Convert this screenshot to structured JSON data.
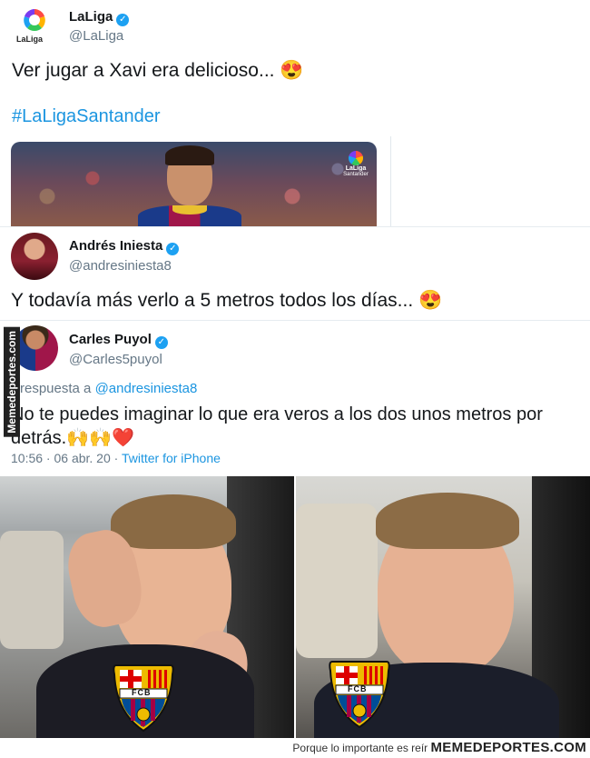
{
  "laliga_tweet": {
    "name": "LaLiga",
    "handle": "@LaLiga",
    "text": "Ver jugar a Xavi era delicioso... 😍",
    "hashtag": "#LaLigaSantander",
    "logo_text": "LaLiga",
    "media_logo_text": "LaLiga",
    "media_logo_sub": "Santander"
  },
  "iniesta_tweet": {
    "name": "Andrés Iniesta",
    "handle": "@andresiniesta8",
    "text": "Y todavía más verlo a 5 metros todos los días... 😍"
  },
  "puyol_tweet": {
    "name": "Carles Puyol",
    "handle": "@Carles5puyol",
    "reply_prefix": "respuesta a",
    "reply_to": "@andresiniesta8",
    "text_line1": "No te puedes imaginar lo que era veros a los dos unos metros por",
    "text_line2": "detrás.🙌🙌❤️",
    "time": "10:56 · 06 abr. 20 · ",
    "source": "Twitter for iPhone"
  },
  "watermark": "Memedeportes.com",
  "crest": {
    "letters": "FCB"
  },
  "footer": {
    "tagline": "Porque lo importante es reír",
    "brand": "MEMEDEPORTES.COM"
  },
  "colors": {
    "twitter_blue": "#1da1f2",
    "link_blue": "#1b95e0",
    "barca_blue": "#004d98",
    "barca_red": "#a50044",
    "barca_gold": "#edbb00"
  }
}
